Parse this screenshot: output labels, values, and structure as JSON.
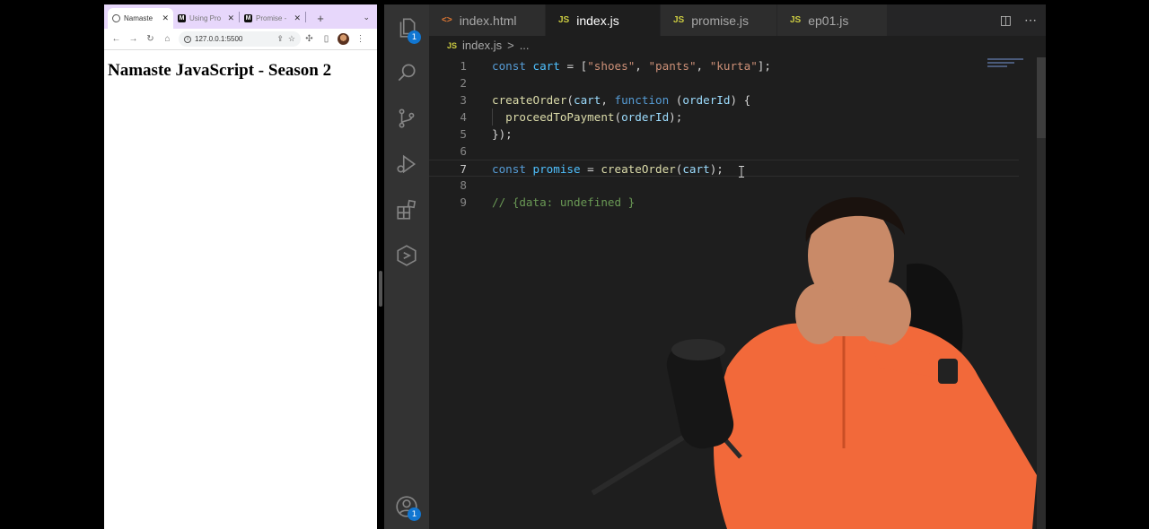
{
  "browser": {
    "tabs": [
      {
        "title": "Namaste",
        "favicon": "globe-icon",
        "active": true
      },
      {
        "title": "Using Pro",
        "favicon": "mdn-icon",
        "active": false
      },
      {
        "title": "Promise -",
        "favicon": "mdn-icon",
        "active": false
      }
    ],
    "url": "127.0.0.1:5500",
    "page": {
      "heading": "Namaste JavaScript - Season 2"
    },
    "colors": {
      "tabstrip": "#e7d7fb"
    }
  },
  "editor": {
    "tabs": [
      {
        "label": "index.html",
        "icon": "<>",
        "type": "html",
        "active": false
      },
      {
        "label": "index.js",
        "icon": "JS",
        "type": "js",
        "active": true,
        "unsaved": true
      },
      {
        "label": "promise.js",
        "icon": "JS",
        "type": "js",
        "active": false
      },
      {
        "label": "ep01.js",
        "icon": "JS",
        "type": "js",
        "active": false
      }
    ],
    "breadcrumb": {
      "icon": "JS",
      "file": "index.js",
      "separator": ">",
      "rest": "..."
    },
    "activity_badges": {
      "explorer": "1",
      "accounts": "1"
    },
    "lines": [
      {
        "n": "1",
        "tokens": [
          [
            "kw",
            "const"
          ],
          [
            "pl",
            " "
          ],
          [
            "var",
            "cart"
          ],
          [
            "pl",
            " = ["
          ],
          [
            "str",
            "\"shoes\""
          ],
          [
            "pl",
            ", "
          ],
          [
            "str",
            "\"pants\""
          ],
          [
            "pl",
            ", "
          ],
          [
            "str",
            "\"kurta\""
          ],
          [
            "pl",
            "];"
          ]
        ]
      },
      {
        "n": "2",
        "tokens": []
      },
      {
        "n": "3",
        "tokens": [
          [
            "fn",
            "createOrder"
          ],
          [
            "pl",
            "("
          ],
          [
            "param",
            "cart"
          ],
          [
            "pl",
            ", "
          ],
          [
            "kw",
            "function"
          ],
          [
            "pl",
            " ("
          ],
          [
            "param",
            "orderId"
          ],
          [
            "pl",
            ") {"
          ]
        ]
      },
      {
        "n": "4",
        "tokens": [
          [
            "pl",
            "  "
          ],
          [
            "fn",
            "proceedToPayment"
          ],
          [
            "pl",
            "("
          ],
          [
            "param",
            "orderId"
          ],
          [
            "pl",
            ");"
          ]
        ],
        "guide": true
      },
      {
        "n": "5",
        "tokens": [
          [
            "pl",
            "});"
          ]
        ]
      },
      {
        "n": "6",
        "tokens": []
      },
      {
        "n": "7",
        "tokens": [
          [
            "kw",
            "const"
          ],
          [
            "pl",
            " "
          ],
          [
            "var",
            "promise"
          ],
          [
            "pl",
            " = "
          ],
          [
            "fn",
            "createOrder"
          ],
          [
            "pl",
            "("
          ],
          [
            "param",
            "cart"
          ],
          [
            "pl",
            ");"
          ]
        ],
        "current": true
      },
      {
        "n": "8",
        "tokens": []
      },
      {
        "n": "9",
        "tokens": [
          [
            "cmt",
            "// {data: undefined }"
          ]
        ]
      }
    ],
    "colors": {
      "background": "#1e1e1e",
      "activity_bar": "#333333",
      "tabs_bar": "#252526",
      "badge": "#1176d1"
    }
  }
}
